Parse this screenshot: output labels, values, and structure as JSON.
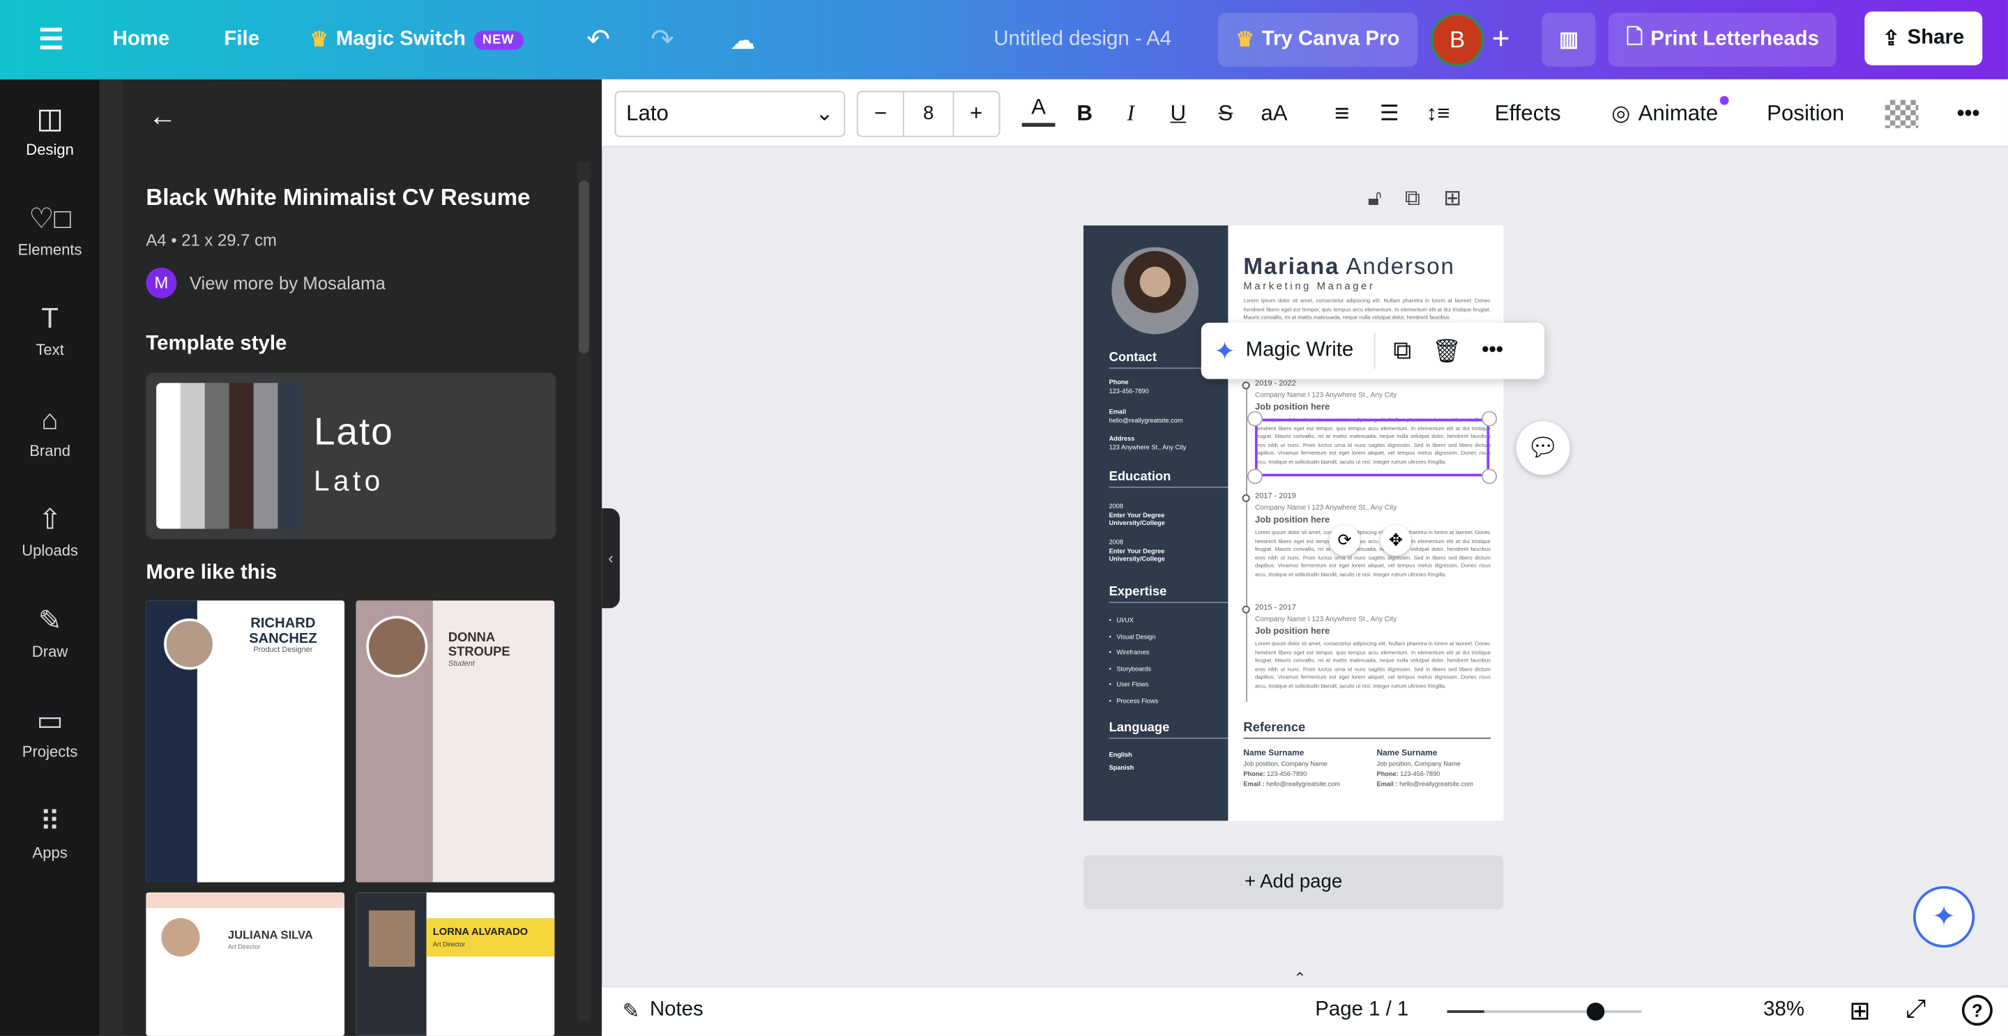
{
  "topbar": {
    "home": "Home",
    "file": "File",
    "magic_switch": "Magic Switch",
    "new_badge": "NEW",
    "title": "Untitled design - A4",
    "try_pro": "Try Canva Pro",
    "avatar": "B",
    "print": "Print Letterheads",
    "share": "Share"
  },
  "rail": [
    {
      "label": "Design",
      "icon": "design-icon"
    },
    {
      "label": "Elements",
      "icon": "elements-icon"
    },
    {
      "label": "Text",
      "icon": "text-icon"
    },
    {
      "label": "Brand",
      "icon": "brand-icon"
    },
    {
      "label": "Uploads",
      "icon": "uploads-icon"
    },
    {
      "label": "Draw",
      "icon": "draw-icon"
    },
    {
      "label": "Projects",
      "icon": "projects-icon"
    },
    {
      "label": "Apps",
      "icon": "apps-icon"
    }
  ],
  "panel": {
    "title": "Black White Minimalist CV Resume",
    "size": "A4 • 21 x 29.7 cm",
    "author_initial": "M",
    "author": "View more by Mosalama",
    "template_style": "Template style",
    "font_big": "Lato",
    "font_small": "Lato",
    "more_like": "More like this",
    "swatches": [
      "#ffffff",
      "#c9c9c9",
      "#6c6c6c",
      "#3b2a23",
      "#8f8f93",
      "#2f3a4b"
    ],
    "thumbs": [
      {
        "name": "RICHARD SANCHEZ",
        "role": "Product Designer"
      },
      {
        "name": "DONNA STROUPE",
        "role": "Student"
      },
      {
        "name": "JULIANA SILVA",
        "role": "Art Director"
      },
      {
        "name": "LORNA ALVARADO",
        "role": "Art Director"
      }
    ]
  },
  "toolbar": {
    "font": "Lato",
    "size": "8",
    "minus": "−",
    "plus": "+",
    "effects": "Effects",
    "animate": "Animate",
    "position": "Position"
  },
  "resume": {
    "first": "Mariana",
    "last": "Anderson",
    "role": "Marketing Manager",
    "intro": "Lorem ipsum dolor sit amet, consectetur adipiscing elit. Nullam pharetra in lorem at laoreet. Donec hendrerit libero eget est tempor, quis tempus arcu elementum. In elementum elit at dui tristique feugiat. Mauris convallis, mi at mattis malesuada, neque nulla volutpat dolor, hendrerit faucibus",
    "contact": "Contact",
    "phone_label": "Phone",
    "phone": "123-456-7890",
    "email_label": "Email",
    "email": "hello@reallygreatsite.com",
    "address_label": "Address",
    "address": "123 Anywhere St., Any City",
    "education": "Education",
    "edu": [
      {
        "year": "2008",
        "degree": "Enter Your Degree",
        "school": "University/College"
      },
      {
        "year": "2008",
        "degree": "Enter Your Degree",
        "school": "University/College"
      }
    ],
    "expertise": "Expertise",
    "skills": [
      "UI/UX",
      "Visual Design",
      "Wireframes",
      "Storyboards",
      "User Flows",
      "Process Flows"
    ],
    "language": "Language",
    "languages": [
      "English",
      "Spanish"
    ],
    "jobs": [
      {
        "years": "2019 - 2022",
        "company": "Company Name I 123 Anywhere St., Any City",
        "title": "Job position here"
      },
      {
        "years": "2017 - 2019",
        "company": "Company Name I 123 Anywhere St., Any City",
        "title": "Job position here"
      },
      {
        "years": "2015 - 2017",
        "company": "Company Name I 123 Anywhere St., Any City",
        "title": "Job position here"
      }
    ],
    "job_text": "Lorem ipsum dolor sit amet, consectetur adipiscing elit. Nullam pharetra in lorem at laoreet. Donec hendrerit libero eget est tempor, quis tempus arcu elementum. In elementum elit at dui tristique feugiat. Mauris convallis, mi at mattis malesuada, neque nulla volutpat dolor, hendrerit faucibus eros nibh ut nunc. Proin luctus urna id nunc sagittis dignissim. Sed in libero sed libero dictum dapibus. Vivamus fermentum est eget lorem aliquet, vel tempus metus dignissim. Donec risus arcu, tristique et sollicitudin blandit, iaculis ut nisl. Integer rutrum ultricies fringilla.",
    "reference": "Reference",
    "refs": [
      {
        "name": "Name Surname",
        "pos": "Job position, Company Name",
        "phone_label": "Phone:",
        "phone": "123-456-7890",
        "email_label": "Email :",
        "email": "hello@reallygreatsite.com"
      },
      {
        "name": "Name Surname",
        "pos": "Job position, Company Name",
        "phone_label": "Phone:",
        "phone": "123-456-7890",
        "email_label": "Email :",
        "email": "hello@reallygreatsite.com"
      }
    ]
  },
  "magic_write": "Magic Write",
  "add_page": "+ Add page",
  "bottom": {
    "notes": "Notes",
    "page": "Page 1 / 1",
    "zoom": "38%",
    "zoom_level": 38
  }
}
